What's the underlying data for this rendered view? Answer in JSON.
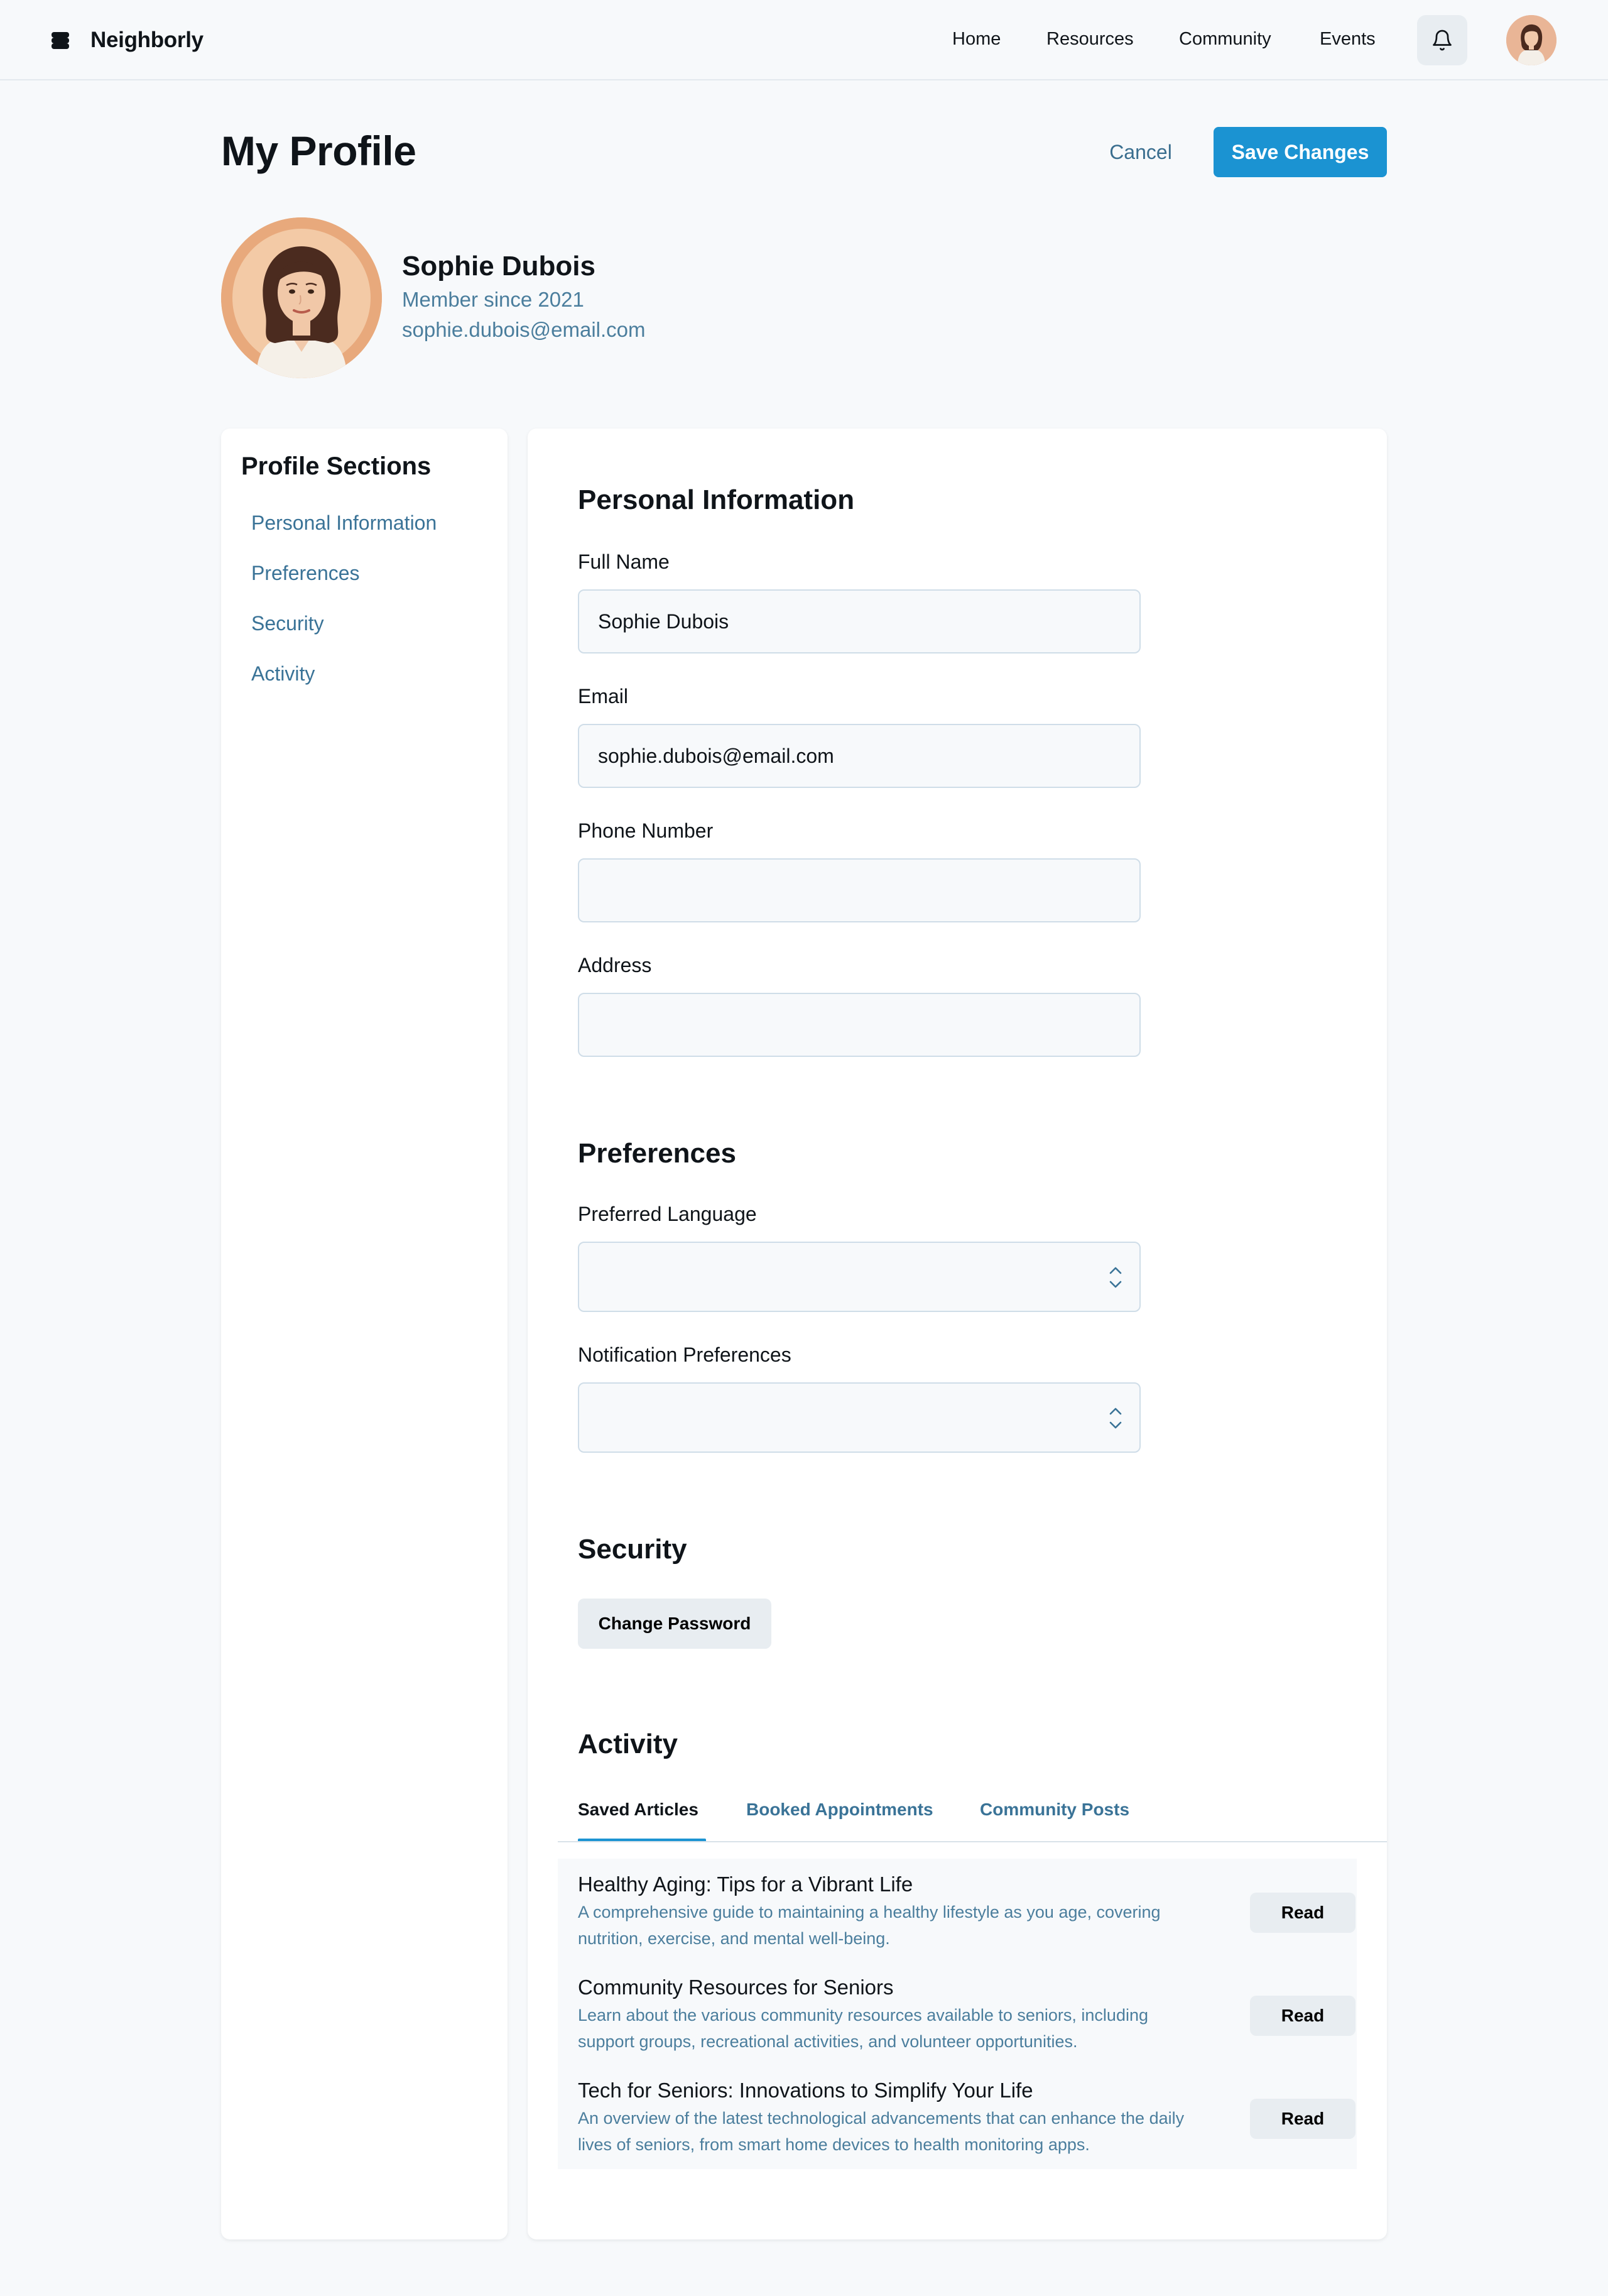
{
  "app": {
    "name": "Neighborly",
    "icon": "stack-logo-icon"
  },
  "nav": {
    "links": [
      "Home",
      "Resources",
      "Community",
      "Events"
    ],
    "bell_icon": "bell-icon",
    "avatar_icon": "user-avatar"
  },
  "header": {
    "title": "My Profile",
    "cancel_label": "Cancel",
    "save_label": "Save Changes"
  },
  "profile": {
    "name": "Sophie Dubois",
    "member_since": "Member since 2021",
    "email": "sophie.dubois@email.com"
  },
  "sidebar": {
    "title": "Profile Sections",
    "items": [
      "Personal Information",
      "Preferences",
      "Security",
      "Activity"
    ]
  },
  "personal": {
    "title": "Personal Information",
    "full_name_label": "Full Name",
    "full_name_value": "Sophie Dubois",
    "email_label": "Email",
    "email_value": "sophie.dubois@email.com",
    "phone_label": "Phone Number",
    "phone_value": "",
    "address_label": "Address",
    "address_value": ""
  },
  "preferences": {
    "title": "Preferences",
    "language_label": "Preferred Language",
    "language_value": "",
    "notification_label": "Notification Preferences",
    "notification_value": ""
  },
  "security": {
    "title": "Security",
    "change_password_label": "Change Password"
  },
  "activity": {
    "title": "Activity",
    "tabs": [
      "Saved Articles",
      "Booked Appointments",
      "Community Posts"
    ],
    "active_tab": "Saved Articles",
    "articles": [
      {
        "title": "Healthy Aging: Tips for a Vibrant Life",
        "desc": "A comprehensive guide to maintaining a healthy lifestyle as you age, covering nutrition, exercise, and mental well-being.",
        "action": "Read"
      },
      {
        "title": "Community Resources for Seniors",
        "desc": "Learn about the various community resources available to seniors, including support groups, recreational activities, and volunteer opportunities.",
        "action": "Read"
      },
      {
        "title": "Tech for Seniors: Innovations to Simplify Your Life",
        "desc": "An overview of the latest technological advancements that can enhance the daily lives of seniors, from smart home devices to health monitoring apps.",
        "action": "Read"
      }
    ]
  },
  "colors": {
    "accent": "#1b93d2",
    "link": "#3a7397",
    "muted": "#4b7e9d",
    "background": "#f7f9fb",
    "card": "#ffffff",
    "button_secondary": "#e8edf1"
  }
}
